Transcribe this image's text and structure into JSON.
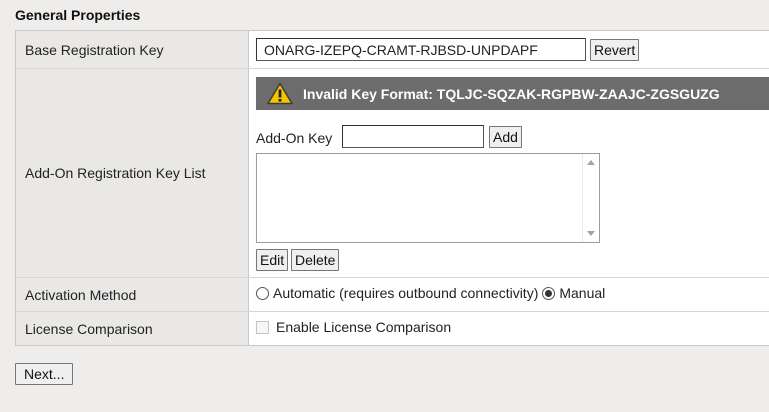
{
  "section": {
    "title": "General Properties"
  },
  "base_key": {
    "label": "Base Registration Key",
    "value": "ONARG-IZEPQ-CRAMT-RJBSD-UNPDAPF",
    "revert_label": "Revert"
  },
  "addon": {
    "label": "Add-On Registration Key List",
    "error_message": "Invalid Key Format: TQLJC-SQZAK-RGPBW-ZAAJC-ZGSGUZG",
    "key_label": "Add-On Key",
    "key_value": "",
    "add_label": "Add",
    "edit_label": "Edit",
    "delete_label": "Delete",
    "list_items": []
  },
  "activation": {
    "label": "Activation Method",
    "options": [
      {
        "label": "Automatic (requires outbound connectivity)",
        "checked": false
      },
      {
        "label": "Manual",
        "checked": true
      }
    ]
  },
  "license": {
    "label": "License Comparison",
    "checkbox_label": "Enable License Comparison",
    "checked": false,
    "disabled": true
  },
  "footer": {
    "next_label": "Next..."
  },
  "colors": {
    "page_bg": "#eeedeb",
    "label_bg": "#e9e8e6",
    "error_banner_bg": "#6c6c6c",
    "warning_icon": "#f5c400"
  }
}
